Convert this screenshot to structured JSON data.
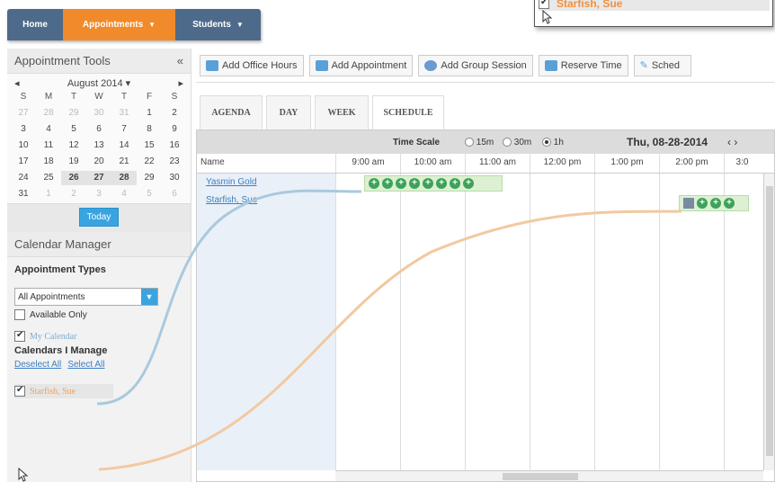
{
  "nav": {
    "home": "Home",
    "appointments": "Appointments",
    "students": "Students"
  },
  "popup": {
    "name": "Starfish, Sue"
  },
  "sidebar": {
    "tools_title": "Appointment Tools",
    "collapse": "«",
    "calendar": {
      "month": "August 2014 ▾",
      "prev": "◂",
      "next": "▸",
      "dow": [
        "S",
        "M",
        "T",
        "W",
        "T",
        "F",
        "S"
      ],
      "rows": [
        [
          "27",
          "28",
          "29",
          "30",
          "31",
          "1",
          "2"
        ],
        [
          "3",
          "4",
          "5",
          "6",
          "7",
          "8",
          "9"
        ],
        [
          "10",
          "11",
          "12",
          "13",
          "14",
          "15",
          "16"
        ],
        [
          "17",
          "18",
          "19",
          "20",
          "21",
          "22",
          "23"
        ],
        [
          "24",
          "25",
          "26",
          "27",
          "28",
          "29",
          "30"
        ],
        [
          "31",
          "1",
          "2",
          "3",
          "4",
          "5",
          "6"
        ]
      ]
    },
    "today": "Today",
    "manager_title": "Calendar Manager",
    "appointment_types_label": "Appointment Types",
    "appointment_select": "All Appointments",
    "available_only": "Available Only",
    "my_calendar": "My Calendar",
    "calendars_manage": "Calendars I Manage",
    "deselect_all": "Deselect All",
    "select_all": "Select All",
    "starfish_sue": "Starfish, Sue"
  },
  "toolbar": {
    "add_office_hours": "Add Office Hours",
    "add_appointment": "Add Appointment",
    "add_group_session": "Add Group Session",
    "reserve_time": "Reserve Time",
    "schedule": "Sched"
  },
  "tabs": [
    "AGENDA",
    "DAY",
    "WEEK",
    "SCHEDULE"
  ],
  "schedule": {
    "time_scale": "Time Scale",
    "opt15": "15m",
    "opt30": "30m",
    "opt1h": "1h",
    "date": "Thu, 08-28-2014",
    "date_nav": "‹ ›",
    "name_header": "Name",
    "times": [
      "9:00 am",
      "10:00 am",
      "11:00 am",
      "12:00 pm",
      "1:00 pm",
      "2:00 pm",
      "3:0"
    ],
    "people": [
      "Yasmin Gold",
      "Starfish, Sue"
    ]
  },
  "colors": {
    "accent": "#f08a2a",
    "nav": "#4e6a8a",
    "slot": "#3ea35a",
    "curve_blue": "#a9c9de",
    "curve_orange": "#f2c9a0"
  }
}
